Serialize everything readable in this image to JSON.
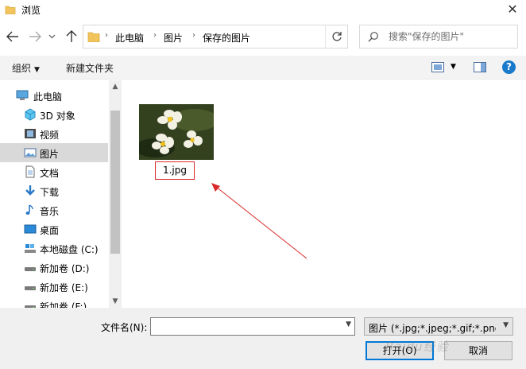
{
  "window": {
    "title": "浏览"
  },
  "address": {
    "crumbs": [
      "此电脑",
      "图片",
      "保存的图片"
    ]
  },
  "search": {
    "placeholder": "搜索\"保存的图片\""
  },
  "toolbar": {
    "organize_label": "组织",
    "new_folder_label": "新建文件夹"
  },
  "sidebar": {
    "items": [
      {
        "label": "此电脑",
        "icon": "computer-icon"
      },
      {
        "label": "3D 对象",
        "icon": "3d-objects-icon"
      },
      {
        "label": "视频",
        "icon": "video-icon"
      },
      {
        "label": "图片",
        "icon": "pictures-icon",
        "selected": true
      },
      {
        "label": "文档",
        "icon": "document-icon"
      },
      {
        "label": "下载",
        "icon": "download-icon"
      },
      {
        "label": "音乐",
        "icon": "music-icon"
      },
      {
        "label": "桌面",
        "icon": "desktop-icon"
      },
      {
        "label": "本地磁盘 (C:)",
        "icon": "drive-icon"
      },
      {
        "label": "新加卷 (D:)",
        "icon": "drive-icon"
      },
      {
        "label": "新加卷 (E:)",
        "icon": "drive-icon"
      },
      {
        "label": "新加卷 (F:)",
        "icon": "drive-icon"
      }
    ]
  },
  "files": [
    {
      "name": "1.jpg"
    }
  ],
  "footer": {
    "filename_label": "文件名(N):",
    "filename_value": "",
    "filter_value": "图片 (*.jpg;*.jpeg;*.gif;*.png;*",
    "open_label": "打开(O)",
    "cancel_label": "取消"
  },
  "watermark": "Baidu经验",
  "colors": {
    "highlight_box": "#d92b2b",
    "help_blue": "#1979ca",
    "primary_border": "#0078d7",
    "selected_bg": "#d9d9d9"
  }
}
